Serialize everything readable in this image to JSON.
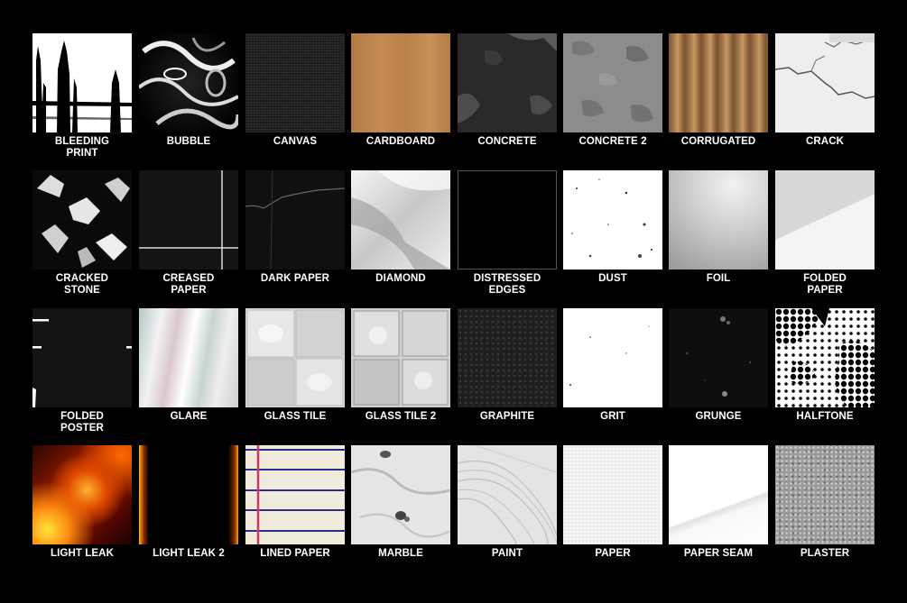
{
  "textures": [
    {
      "label": "BLEEDING\nPRINT"
    },
    {
      "label": "BUBBLE"
    },
    {
      "label": "CANVAS"
    },
    {
      "label": "CARDBOARD"
    },
    {
      "label": "CONCRETE"
    },
    {
      "label": "CONCRETE 2"
    },
    {
      "label": "CORRUGATED"
    },
    {
      "label": "CRACK"
    },
    {
      "label": "CRACKED\nSTONE"
    },
    {
      "label": "CREASED\nPAPER"
    },
    {
      "label": "DARK PAPER"
    },
    {
      "label": "DIAMOND"
    },
    {
      "label": "DISTRESSED\nEDGES"
    },
    {
      "label": "DUST"
    },
    {
      "label": "FOIL"
    },
    {
      "label": "FOLDED\nPAPER"
    },
    {
      "label": "FOLDED\nPOSTER"
    },
    {
      "label": "GLARE"
    },
    {
      "label": "GLASS TILE"
    },
    {
      "label": "GLASS TILE 2"
    },
    {
      "label": "GRAPHITE"
    },
    {
      "label": "GRIT"
    },
    {
      "label": "GRUNGE"
    },
    {
      "label": "HALFTONE"
    },
    {
      "label": "LIGHT LEAK"
    },
    {
      "label": "LIGHT LEAK 2"
    },
    {
      "label": "LINED PAPER"
    },
    {
      "label": "MARBLE"
    },
    {
      "label": "PAINT"
    },
    {
      "label": "PAPER"
    },
    {
      "label": "PAPER SEAM"
    },
    {
      "label": "PLASTER"
    }
  ]
}
